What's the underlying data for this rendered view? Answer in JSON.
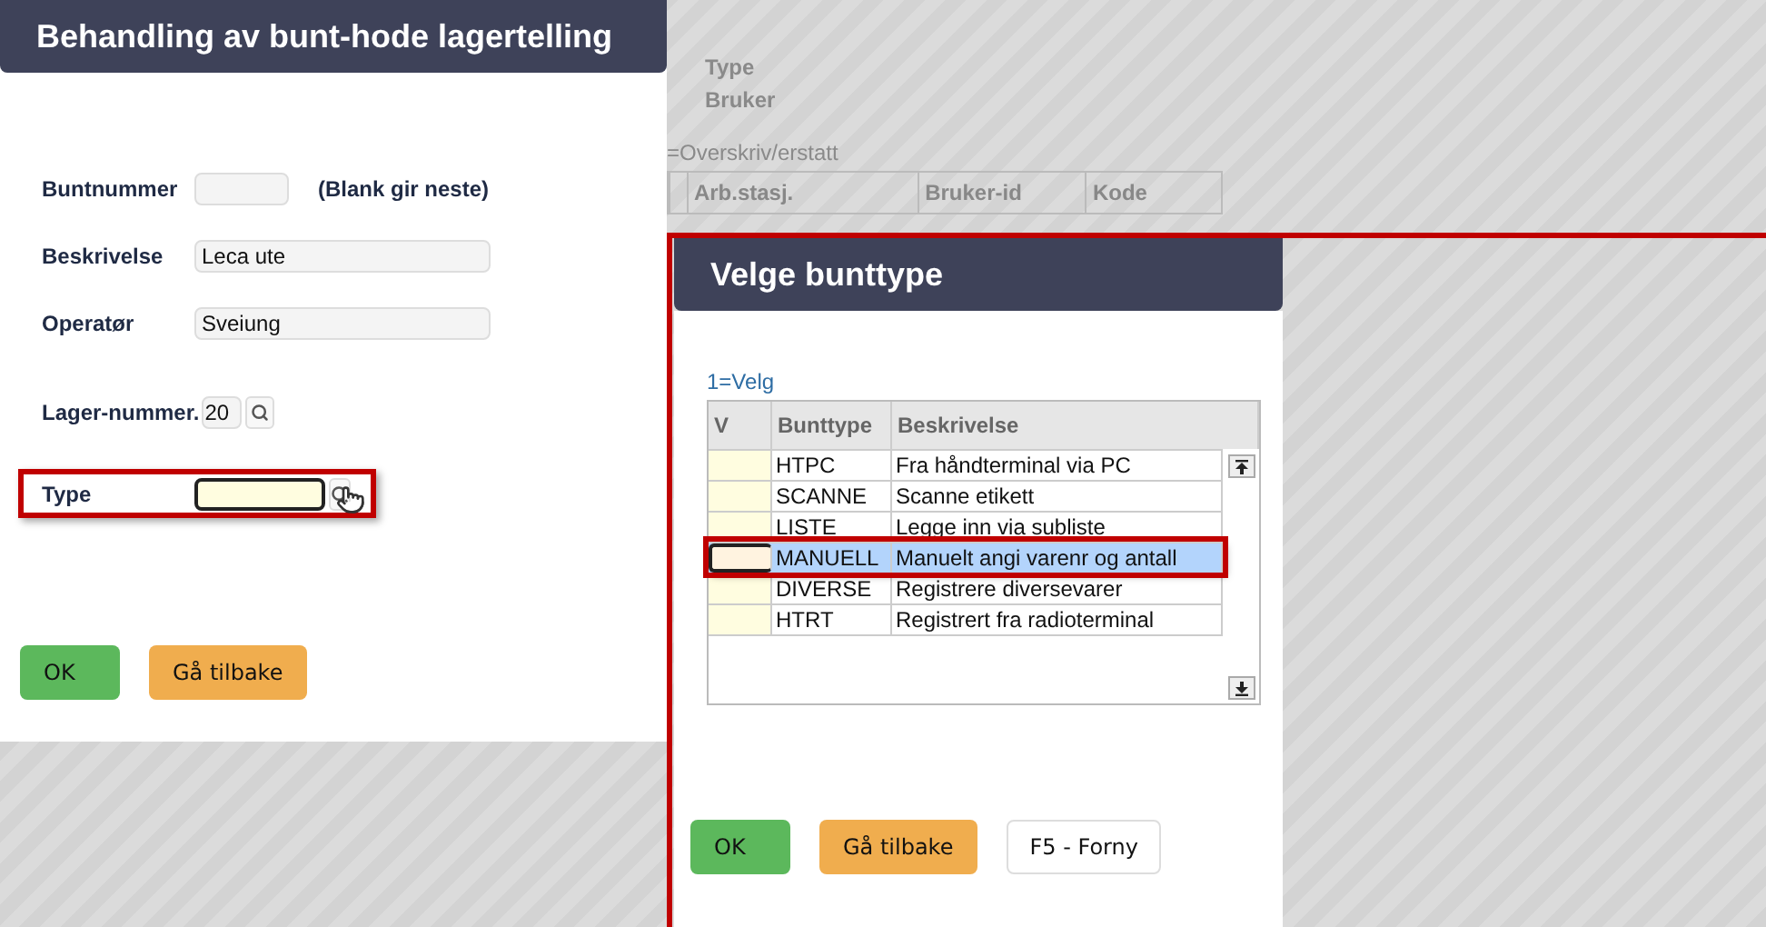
{
  "main_dialog": {
    "title": "Behandling av bunt-hode lagertelling",
    "fields": [
      {
        "kind": "short",
        "label": "Buntnummer",
        "hint": "(Blank gir neste)",
        "focused": false,
        "highlighted": false
      },
      {
        "kind": "wide",
        "label": "Beskrivelse",
        "value": "Leca ute",
        "focused": false,
        "highlighted": false
      },
      {
        "kind": "wide",
        "label": "Operatør",
        "value": "Sveiung",
        "focused": false,
        "highlighted": false
      },
      {
        "kind": "code",
        "label": "Lager-nummer.",
        "value": "20",
        "focused": false,
        "highlighted": false
      },
      {
        "kind": "lookup",
        "label": "Type",
        "focused": true,
        "highlighted": true
      }
    ],
    "buttons": [
      {
        "kind": "ok",
        "label": "OK"
      },
      {
        "kind": "back",
        "label": "Gå tilbake"
      }
    ]
  },
  "background": {
    "labels": [
      "Type",
      "Bruker"
    ],
    "note": "=Overskriv/erstatt",
    "table_columns": [
      "Arb.stasj.",
      "Bruker-id",
      "Kode"
    ]
  },
  "type_dialog": {
    "title": "Velge bunttype",
    "hint": "1=Velg",
    "columns": [
      "V",
      "Bunttype",
      "Beskrivelse"
    ],
    "rows": [
      {
        "code": "HTPC",
        "description": "Fra håndterminal via PC",
        "selected": false,
        "highlighted": false
      },
      {
        "code": "SCANNE",
        "description": "Scanne etikett",
        "selected": false,
        "highlighted": false
      },
      {
        "code": "LISTE",
        "description": "Legge inn via subliste",
        "selected": false,
        "highlighted": false
      },
      {
        "code": "MANUELL",
        "description": "Manuelt angi varenr og antall",
        "selected": true,
        "highlighted": true
      },
      {
        "code": "DIVERSE",
        "description": "Registrere diversevarer",
        "selected": false,
        "highlighted": false
      },
      {
        "code": "HTRT",
        "description": "Registrert fra radioterminal",
        "selected": false,
        "highlighted": false
      }
    ],
    "buttons": [
      {
        "kind": "ok",
        "label": "OK"
      },
      {
        "kind": "back",
        "label": "Gå tilbake"
      },
      {
        "kind": "plain",
        "label": "F5 - Forny"
      }
    ]
  }
}
